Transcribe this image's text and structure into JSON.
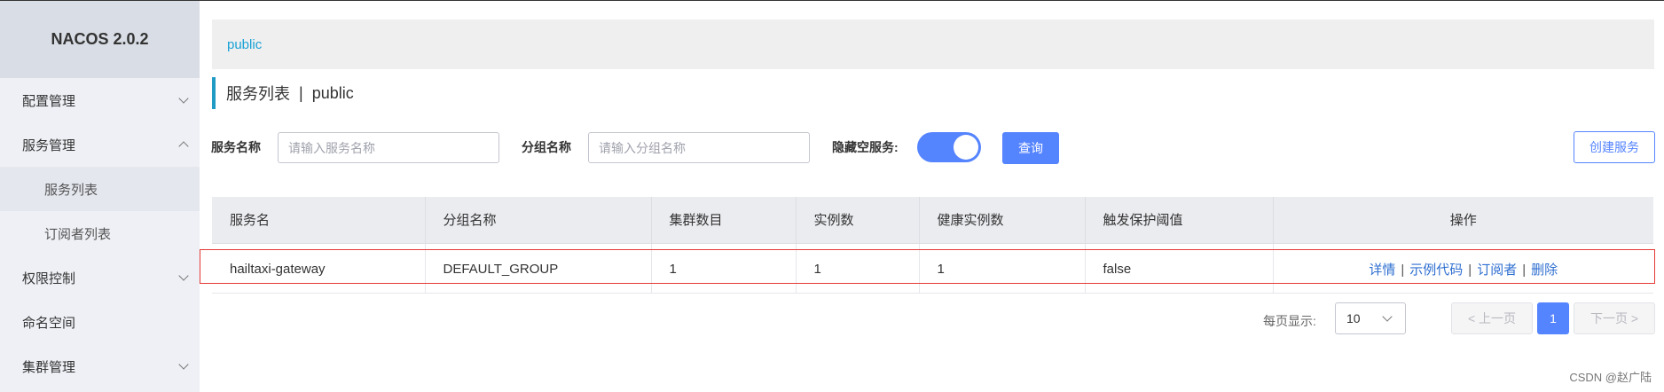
{
  "app": {
    "logo": "NACOS 2.0.2"
  },
  "sidebar": {
    "items": [
      {
        "label": "配置管理",
        "expanded": false
      },
      {
        "label": "服务管理",
        "expanded": true
      },
      {
        "label": "服务列表",
        "sub": true,
        "active": true
      },
      {
        "label": "订阅者列表",
        "sub": true
      },
      {
        "label": "权限控制",
        "expanded": false
      },
      {
        "label": "命名空间"
      },
      {
        "label": "集群管理",
        "expanded": false
      }
    ]
  },
  "breadcrumb": {
    "namespace": "public"
  },
  "title": {
    "main": "服务列表",
    "separator": "|",
    "namespace": "public"
  },
  "filters": {
    "service_name_label": "服务名称",
    "service_name_placeholder": "请输入服务名称",
    "group_name_label": "分组名称",
    "group_name_placeholder": "请输入分组名称",
    "hide_empty_label": "隐藏空服务:",
    "hide_empty_on": true,
    "query_button": "查询",
    "create_button": "创建服务"
  },
  "table": {
    "headers": [
      "服务名",
      "分组名称",
      "集群数目",
      "实例数",
      "健康实例数",
      "触发保护阈值",
      "操作"
    ],
    "rows": [
      {
        "service": "hailtaxi-gateway",
        "group": "DEFAULT_GROUP",
        "clusters": "1",
        "instances": "1",
        "healthy": "1",
        "protect_threshold": "false",
        "actions": [
          "详情",
          "示例代码",
          "订阅者",
          "删除"
        ]
      }
    ]
  },
  "pagination": {
    "page_size_label": "每页显示:",
    "page_size": "10",
    "prev": "< 上一页",
    "current": "1",
    "next": "下一页 >"
  },
  "watermark": "CSDN @赵广陆",
  "colors": {
    "primary": "#5584ff",
    "link": "#19a1d6",
    "highlight": "#e53935"
  }
}
